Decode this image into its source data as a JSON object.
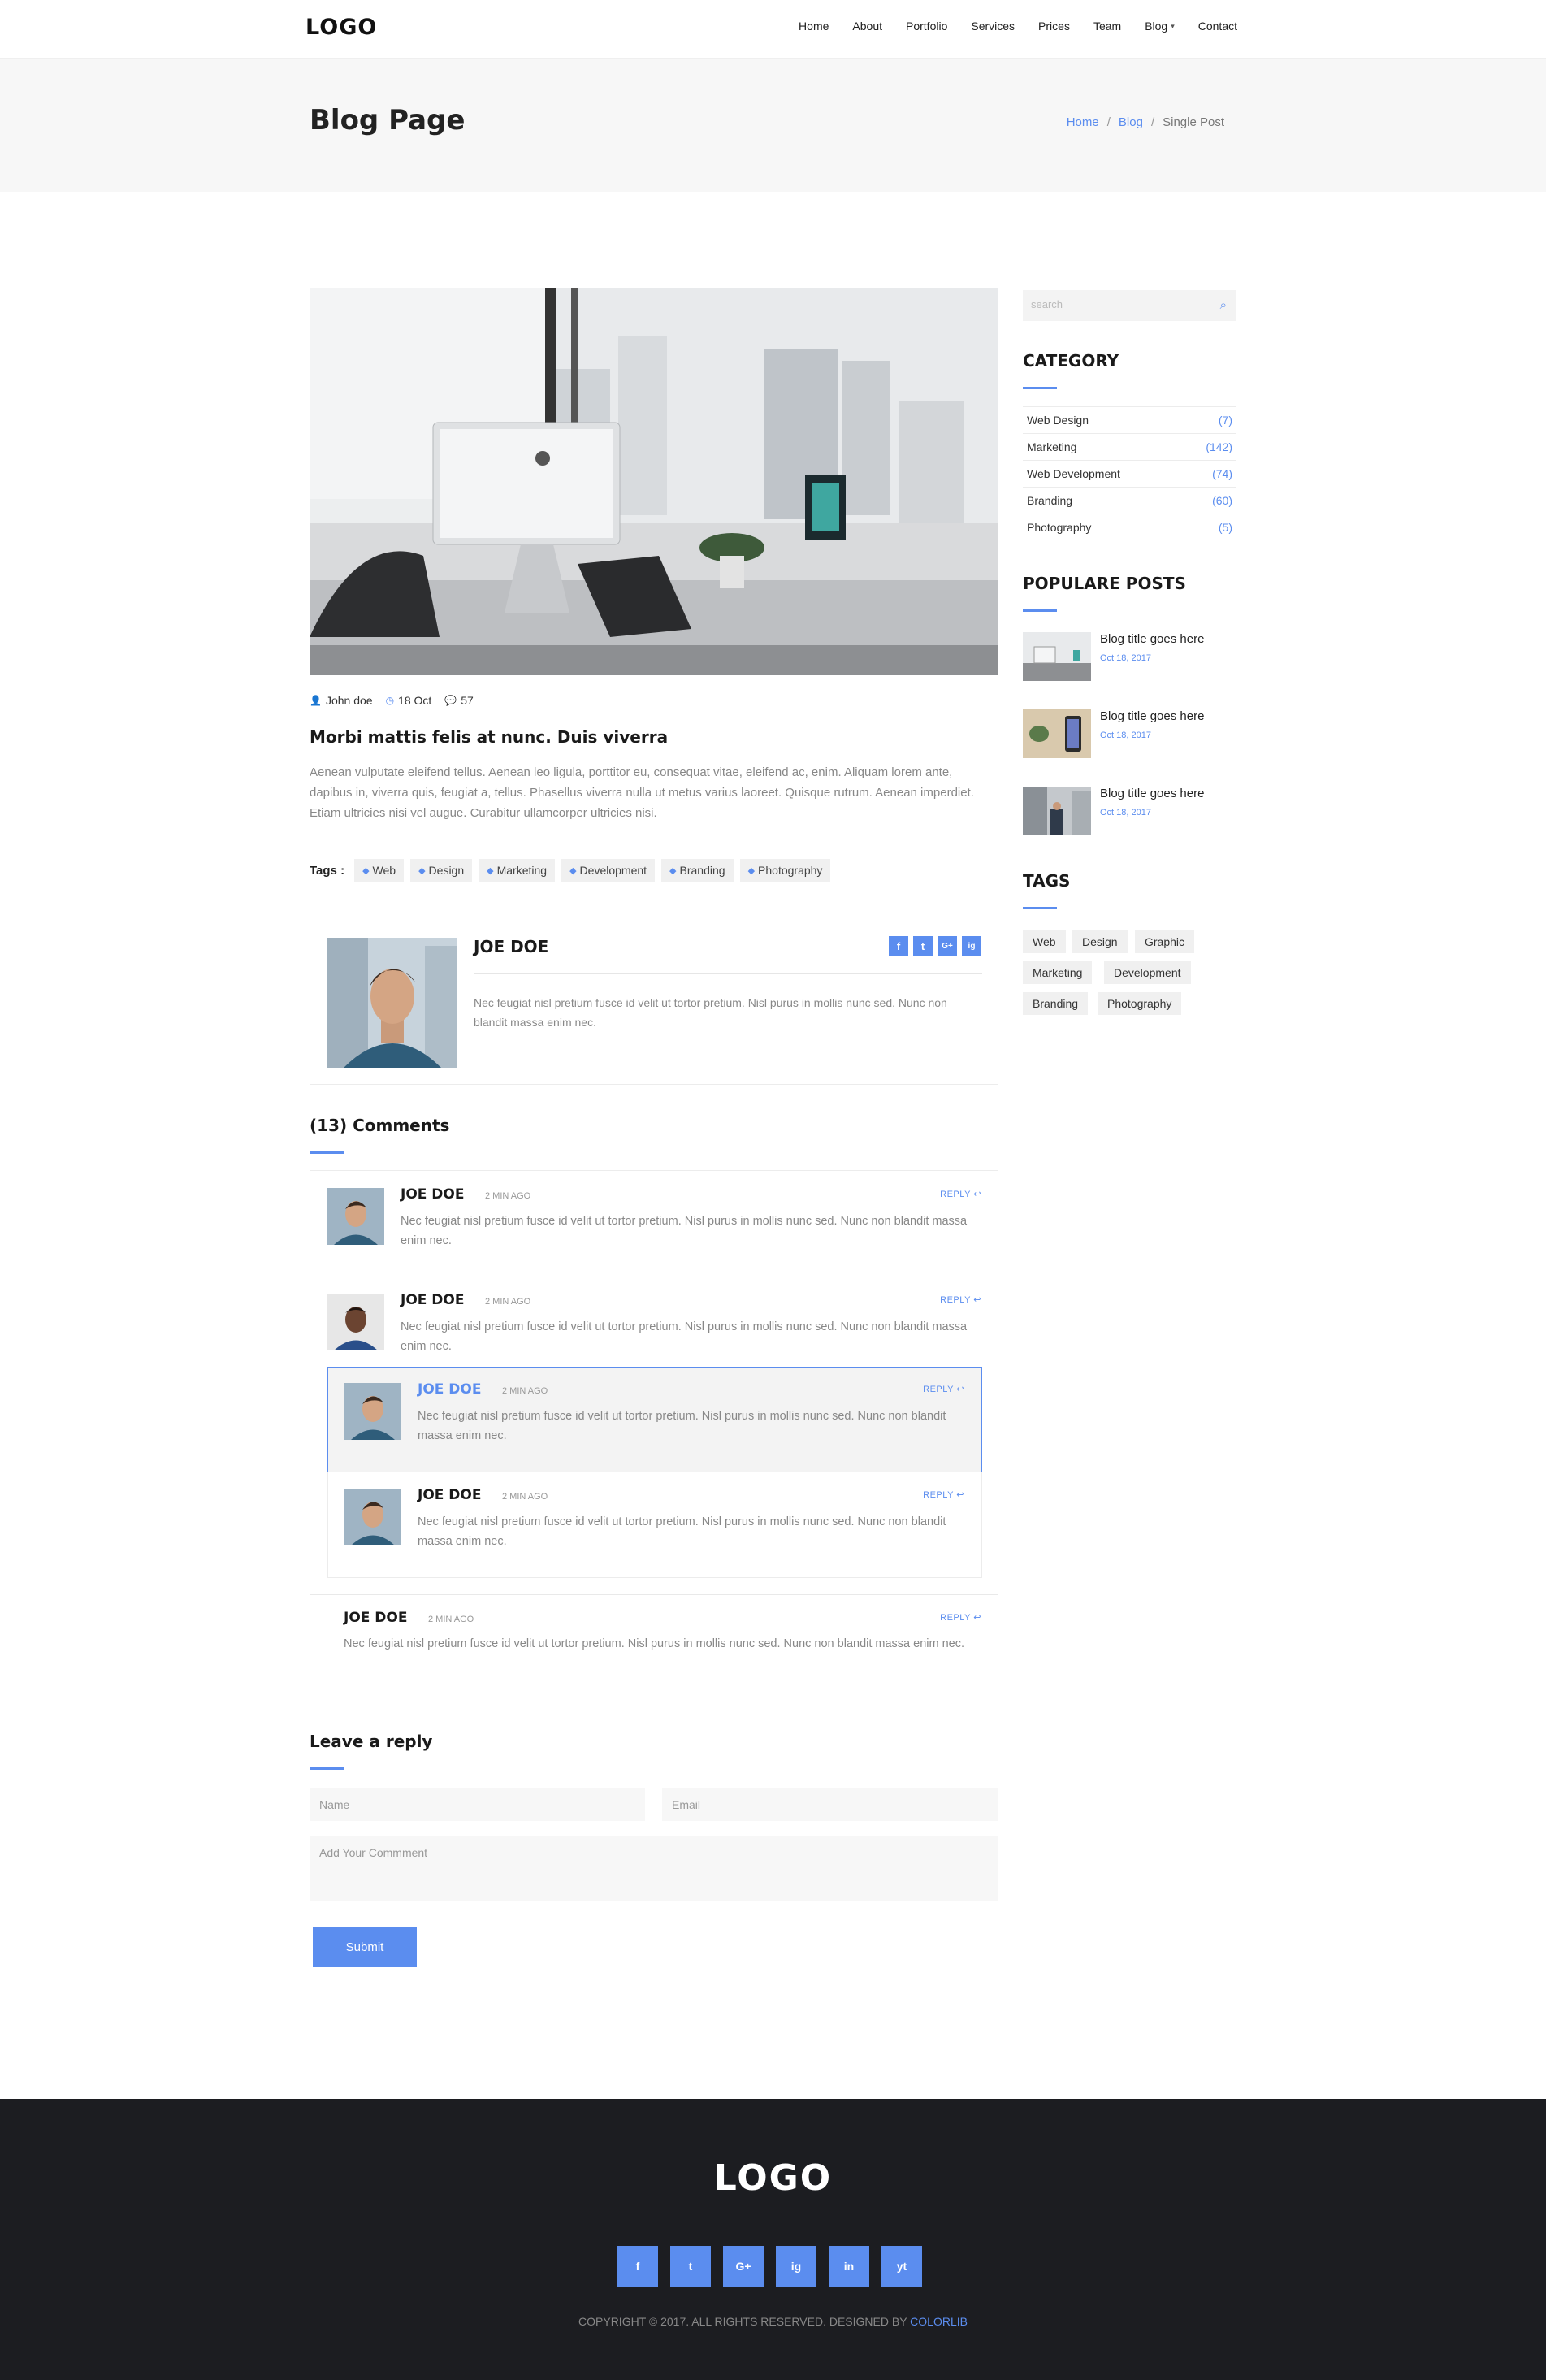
{
  "nav": {
    "logo": "LOGO",
    "items": [
      {
        "label": "Home"
      },
      {
        "label": "About"
      },
      {
        "label": "Portfolio"
      },
      {
        "label": "Services"
      },
      {
        "label": "Prices"
      },
      {
        "label": "Team"
      },
      {
        "label": "Blog"
      },
      {
        "label": "Contact"
      }
    ]
  },
  "header": {
    "title": "Blog Page",
    "breadcrumb": [
      "Home",
      "Blog",
      "Single Post"
    ]
  },
  "post": {
    "author": "John doe",
    "date": "18 Oct",
    "comment_count": "57",
    "title": "Morbi mattis felis at nunc. Duis viverra",
    "body": "Aenean vulputate eleifend tellus. Aenean leo ligula, porttitor eu, consequat vitae, eleifend ac, enim. Aliquam lorem ante, dapibus in, viverra quis, feugiat a, tellus. Phasellus viverra nulla ut metus varius laoreet. Quisque rutrum. Aenean imperdiet. Etiam ultricies nisi vel augue. Curabitur ullamcorper ultricies nisi.",
    "tags_label": "Tags :",
    "tags": [
      "Web",
      "Design",
      "Marketing",
      "Development",
      "Branding",
      "Photography"
    ]
  },
  "author_box": {
    "name": "JOE DOE",
    "bio": "Nec feugiat nisl pretium fusce id velit ut tortor pretium. Nisl purus in mollis nunc sed. Nunc non blandit massa enim nec.",
    "socials": [
      "f",
      "t",
      "G+",
      "ig"
    ]
  },
  "comments": {
    "title": "(13) Comments",
    "reply_label": "REPLY",
    "items": [
      {
        "name": "JOE DOE",
        "time": "2 MIN AGO",
        "text": "Nec feugiat nisl pretium fusce id velit ut tortor pretium. Nisl purus in mollis nunc sed. Nunc non blandit massa enim nec."
      },
      {
        "name": "JOE DOE",
        "time": "2 MIN AGO",
        "text": "Nec feugiat nisl pretium fusce id velit ut tortor pretium. Nisl purus in mollis nunc sed. Nunc non blandit massa enim nec."
      },
      {
        "name": "JOE DOE",
        "time": "2 MIN AGO",
        "text": "Nec feugiat nisl pretium fusce id velit ut tortor pretium. Nisl purus in mollis nunc sed. Nunc non blandit massa enim nec."
      },
      {
        "name": "JOE DOE",
        "time": "2 MIN AGO",
        "text": "Nec feugiat nisl pretium fusce id velit ut tortor pretium. Nisl purus in mollis nunc sed. Nunc non blandit massa enim nec."
      },
      {
        "name": "JOE DOE",
        "time": "2 MIN AGO",
        "text": "Nec feugiat nisl pretium fusce id velit ut tortor pretium. Nisl purus in mollis nunc sed. Nunc non blandit massa enim nec."
      }
    ]
  },
  "reply_form": {
    "title": "Leave a reply",
    "name_placeholder": "Name",
    "email_placeholder": "Email",
    "comment_placeholder": "Add Your Commment",
    "submit_label": "Submit"
  },
  "sidebar": {
    "search_placeholder": "search",
    "category_title": "CATEGORY",
    "categories": [
      {
        "name": "Web Design",
        "count": "(7)"
      },
      {
        "name": "Marketing",
        "count": "(142)"
      },
      {
        "name": "Web Development",
        "count": "(74)"
      },
      {
        "name": "Branding",
        "count": "(60)"
      },
      {
        "name": "Photography",
        "count": "(5)"
      }
    ],
    "popular_title": "POPULARE POSTS",
    "popular": [
      {
        "title": "Blog title goes here",
        "date": "Oct 18, 2017"
      },
      {
        "title": "Blog title goes here",
        "date": "Oct 18, 2017"
      },
      {
        "title": "Blog title goes here",
        "date": "Oct 18, 2017"
      }
    ],
    "tags_title": "TAGS",
    "tags": [
      "Web",
      "Design",
      "Graphic",
      "Marketing",
      "Development",
      "Branding",
      "Photography"
    ]
  },
  "footer": {
    "logo": "LOGO",
    "socials": [
      "f",
      "t",
      "G+",
      "ig",
      "in",
      "yt"
    ],
    "copyright": "COPYRIGHT © 2017. ALL RIGHTS RESERVED. DESIGNED BY",
    "brand": "COLORLIB"
  },
  "colors": {
    "accent": "#5b8def",
    "footer_bg": "#1c1d21",
    "header_bg": "#f7f7f7"
  }
}
